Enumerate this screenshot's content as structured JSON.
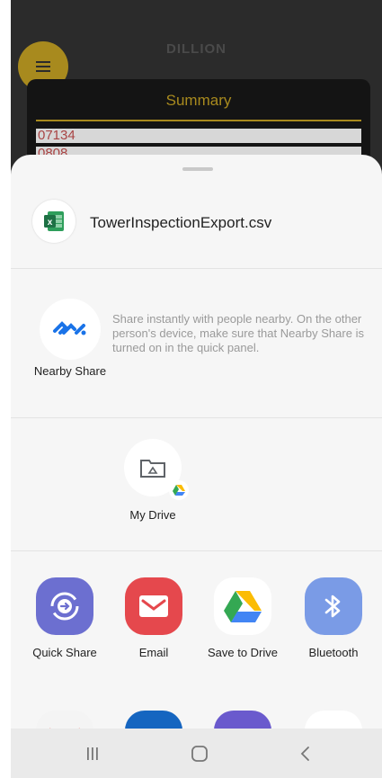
{
  "background_app": {
    "title": "DILLION",
    "summary_title": "Summary",
    "rows": [
      "07134",
      "0808"
    ],
    "colors": {
      "accent": "#a88a1e",
      "row_text": "#a94444"
    }
  },
  "share_sheet": {
    "file": {
      "name": "TowerInspectionExport.csv",
      "icon": "excel-icon"
    },
    "nearby": {
      "label": "Nearby Share",
      "description": "Share instantly with people nearby. On the other person's device, make sure that Nearby Share is turned on in the quick panel.",
      "icon": "nearby-share-icon"
    },
    "direct_share": [
      {
        "label": "My Drive",
        "icon": "drive-folder-icon"
      }
    ],
    "apps": [
      {
        "label": "Quick Share",
        "icon": "quick-share-icon",
        "color": "#6c6fd0"
      },
      {
        "label": "Email",
        "icon": "email-icon",
        "color": "#e5484d"
      },
      {
        "label": "Save to Drive",
        "icon": "google-drive-icon",
        "color": "#ffffff"
      },
      {
        "label": "Bluetooth",
        "icon": "bluetooth-icon",
        "color": "#7a9be6"
      }
    ]
  },
  "navbar": {
    "buttons": [
      "recents-icon",
      "home-icon",
      "back-icon"
    ]
  }
}
